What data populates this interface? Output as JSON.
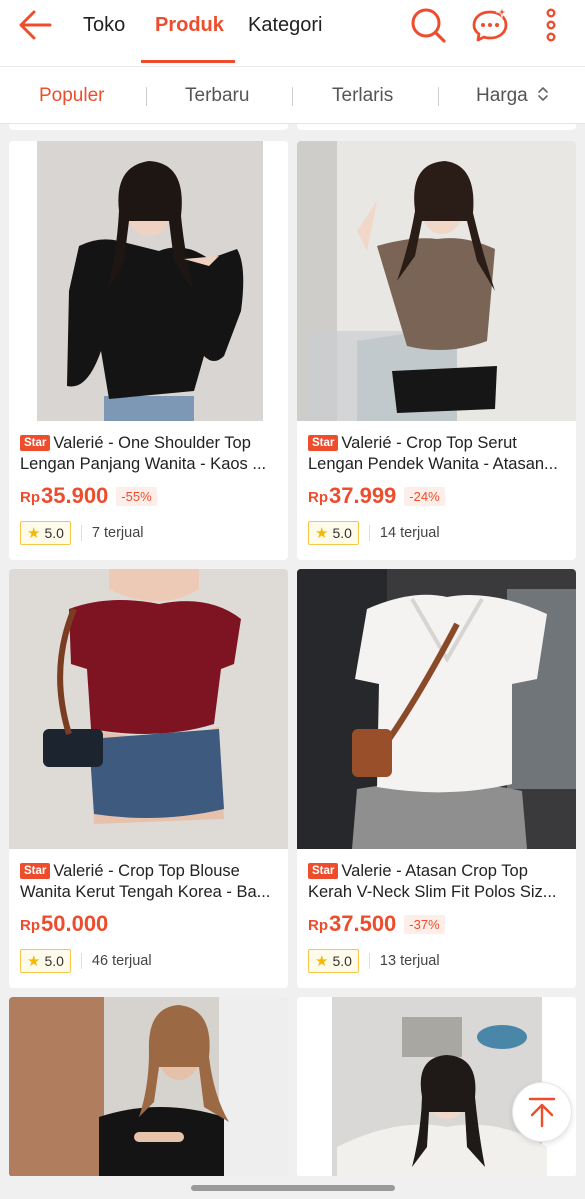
{
  "header": {
    "tabs": [
      "Toko",
      "Produk",
      "Kategori"
    ],
    "active_tab": "Produk",
    "icons": [
      "back-arrow-icon",
      "search-icon",
      "chat-icon",
      "more-vertical-icon"
    ],
    "accent_color": "#ee4d2d"
  },
  "sort_bar": {
    "items": [
      "Populer",
      "Terbaru",
      "Terlaris",
      "Harga"
    ],
    "active": "Populer",
    "price_sort_icon": "sort-updown-icon"
  },
  "products": [
    {
      "badge": "Star",
      "title_line1": "Valerié - One Shoulder Top",
      "title_line2": "Lengan Panjang Wanita - Kaos ...",
      "currency": "Rp",
      "price": "35.900",
      "discount": "-55%",
      "rating": "5.0",
      "sold": "7 terjual"
    },
    {
      "badge": "Star",
      "title_line1": "Valerié - Crop Top Serut",
      "title_line2": "Lengan Pendek Wanita - Atasan...",
      "currency": "Rp",
      "price": "37.999",
      "discount": "-24%",
      "rating": "5.0",
      "sold": "14 terjual"
    },
    {
      "badge": "Star",
      "title_line1": "Valerié - Crop Top Blouse",
      "title_line2": "Wanita Kerut Tengah Korea - Ba...",
      "currency": "Rp",
      "price": "50.000",
      "discount": "",
      "rating": "5.0",
      "sold": "46 terjual"
    },
    {
      "badge": "Star",
      "title_line1": "Valerie - Atasan Crop Top",
      "title_line2": "Kerah V-Neck Slim Fit Polos Siz...",
      "currency": "Rp",
      "price": "37.500",
      "discount": "-37%",
      "rating": "5.0",
      "sold": "13 terjual"
    }
  ],
  "floating": {
    "scroll_top_icon": "arrow-up-to-top-icon"
  }
}
